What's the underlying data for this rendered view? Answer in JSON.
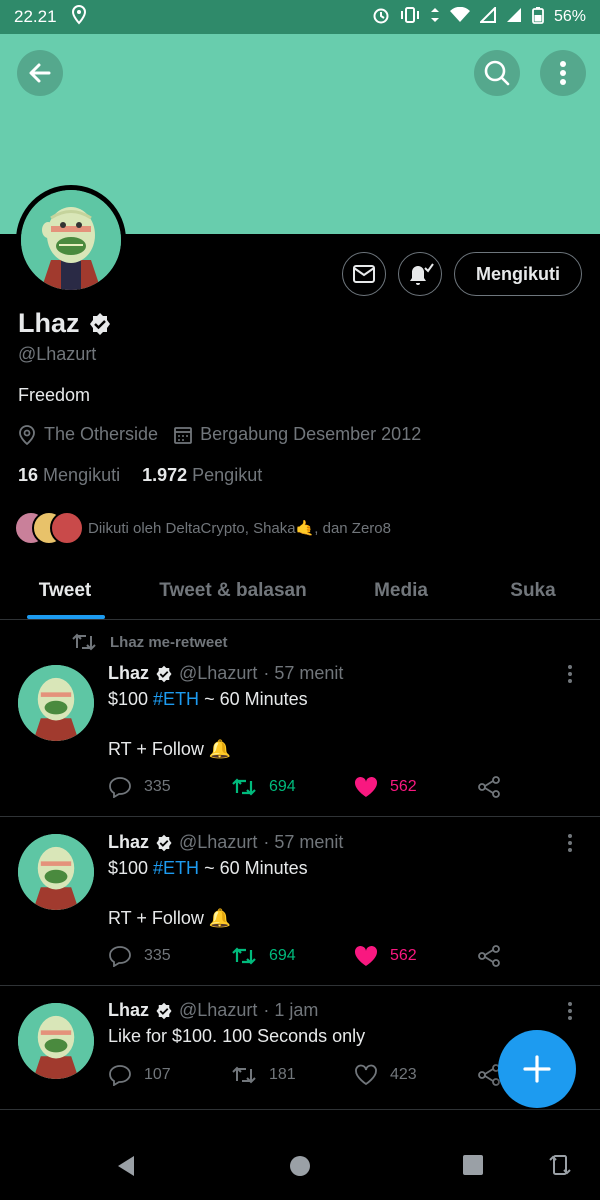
{
  "status_bar": {
    "time": "22.21",
    "battery": "56%"
  },
  "profile": {
    "name": "Lhaz",
    "handle": "@Lhazurt",
    "bio": "Freedom",
    "location": "The Otherside",
    "joined": "Bergabung Desember 2012",
    "following_count": "16",
    "following_label": "Mengikuti",
    "followers_count": "1.972",
    "followers_label": "Pengikut",
    "followed_by": "Diikuti oleh DeltaCrypto, Shaka🤙, dan Zero8",
    "follow_button": "Mengikuti"
  },
  "tabs": [
    {
      "label": "Tweet"
    },
    {
      "label": "Tweet & balasan"
    },
    {
      "label": "Media"
    },
    {
      "label": "Suka"
    }
  ],
  "retweet_label": "Lhaz me-retweet",
  "tweets": [
    {
      "name": "Lhaz",
      "handle": "@Lhazurt",
      "time": "· 57 menit",
      "text_before": "$100 ",
      "hashtag": "#ETH",
      "text_after": " ~ 60 Minutes\n\nRT + Follow 🔔",
      "replies": "335",
      "retweets": "694",
      "likes": "562"
    },
    {
      "name": "Lhaz",
      "handle": "@Lhazurt",
      "time": "· 57 menit",
      "text_before": "$100 ",
      "hashtag": "#ETH",
      "text_after": " ~ 60 Minutes\n\nRT + Follow 🔔",
      "replies": "335",
      "retweets": "694",
      "likes": "562"
    },
    {
      "name": "Lhaz",
      "handle": "@Lhazurt",
      "time": "· 1 jam",
      "text_before": "Like for $100. 100 Seconds only",
      "hashtag": "",
      "text_after": "",
      "replies": "107",
      "retweets": "181",
      "likes": "423"
    }
  ],
  "colors": {
    "banner": "#68cdad",
    "accent": "#1d9bf0",
    "retweet_active": "#00ba7c",
    "like_active": "#f91880"
  }
}
